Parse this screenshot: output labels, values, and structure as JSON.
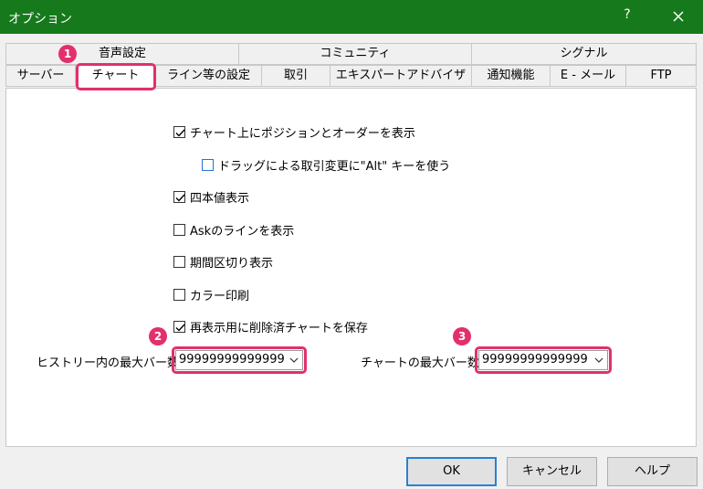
{
  "window": {
    "title": "オプション",
    "help_label": "?",
    "close_icon": "close-icon"
  },
  "tabs": {
    "row1": [
      "音声設定",
      "コミュニティ",
      "シグナル"
    ],
    "row2": [
      "サーバー",
      "チャート",
      "ライン等の設定",
      "取引",
      "エキスパートアドバイザ",
      "通知機能",
      "E - メール",
      "FTP"
    ],
    "selected": "チャート"
  },
  "chart_options": {
    "show_positions": {
      "label": "チャート上にポジションとオーダーを表示",
      "checked": true
    },
    "drag_trade": {
      "label": "ドラッグによる取引変更に\"Alt\" キーを使う",
      "checked": false
    },
    "ohlc": {
      "label": "四本値表示",
      "checked": true
    },
    "ask_line": {
      "label": "Askのラインを表示",
      "checked": false
    },
    "period_sep": {
      "label": "期間区切り表示",
      "checked": false
    },
    "color_print": {
      "label": "カラー印刷",
      "checked": false
    },
    "save_deleted": {
      "label": "再表示用に削除済チャートを保存",
      "checked": true
    }
  },
  "fields": {
    "history_max_bars": {
      "label": "ヒストリー内の最大バー数",
      "value": "99999999999999"
    },
    "chart_max_bars": {
      "label": "チャートの最大バー数：",
      "value": "99999999999999"
    }
  },
  "markers": [
    "1",
    "2",
    "3"
  ],
  "buttons": {
    "ok": "OK",
    "cancel": "キャンセル",
    "help": "ヘルプ"
  },
  "colors": {
    "titlebar": "#16791c",
    "highlight": "#e2306c",
    "default_button_border": "#2b7fd4",
    "checkbox_blue": "#2a6fd6"
  }
}
